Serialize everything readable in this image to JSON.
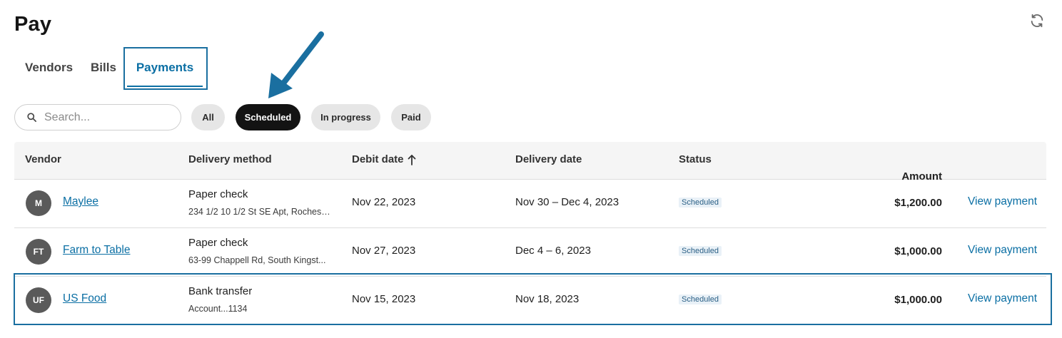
{
  "page": {
    "title": "Pay"
  },
  "tabs": [
    {
      "label": "Vendors"
    },
    {
      "label": "Bills"
    },
    {
      "label": "Payments",
      "active": true
    }
  ],
  "search": {
    "placeholder": "Search...",
    "value": ""
  },
  "filters": [
    {
      "label": "All"
    },
    {
      "label": "Scheduled",
      "selected": true
    },
    {
      "label": "In progress"
    },
    {
      "label": "Paid"
    }
  ],
  "table": {
    "headers": {
      "vendor": "Vendor",
      "delivery_method": "Delivery method",
      "debit_date": "Debit date",
      "delivery_date": "Delivery date",
      "status": "Status",
      "amount": "Amount"
    },
    "rows": [
      {
        "initials": "M",
        "vendor": "Maylee",
        "method": "Paper check",
        "method_detail": "234 1/2 10 1/2 St SE Apt, Rochest...",
        "debit_date": "Nov 22, 2023",
        "delivery_date": "Nov 30 – Dec 4, 2023",
        "status": "Scheduled",
        "amount": "$1,200.00",
        "action": "View payment"
      },
      {
        "initials": "FT",
        "vendor": "Farm to Table",
        "method": "Paper check",
        "method_detail": "63-99 Chappell Rd, South Kingst...",
        "debit_date": "Nov 27, 2023",
        "delivery_date": "Dec 4 – 6, 2023",
        "status": "Scheduled",
        "amount": "$1,000.00",
        "action": "View payment"
      },
      {
        "initials": "UF",
        "vendor": "US Food",
        "method": "Bank transfer",
        "method_detail": "Account...1134",
        "debit_date": "Nov 15, 2023",
        "delivery_date": "Nov 18, 2023",
        "status": "Scheduled",
        "amount": "$1,000.00",
        "action": "View payment"
      }
    ]
  },
  "colors": {
    "accent": "#0b6fa4",
    "annotation": "#1a6fa0",
    "chip_selected": "#131313",
    "chip_default": "#e6e6e6",
    "avatar": "#5a5a5a"
  },
  "icons": {
    "refresh": "refresh-icon",
    "search": "search-icon",
    "sort": "arrow-up-icon",
    "annotation_arrow": "arrow-icon"
  }
}
